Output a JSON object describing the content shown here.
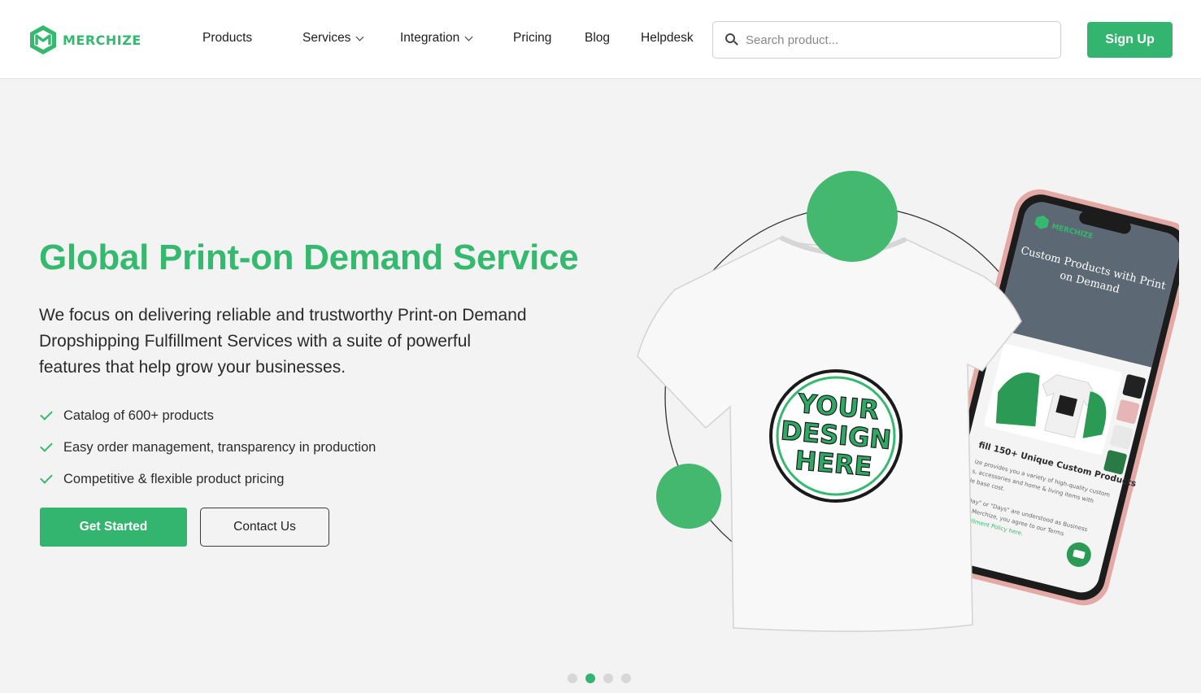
{
  "brand": {
    "name": "MERCHIZE",
    "accent_color": "#35b96f"
  },
  "nav": {
    "items": [
      {
        "label": "Products",
        "has_dropdown": false
      },
      {
        "label": "Services",
        "has_dropdown": true
      },
      {
        "label": "Integration",
        "has_dropdown": true
      },
      {
        "label": "Pricing",
        "has_dropdown": false
      },
      {
        "label": "Blog",
        "has_dropdown": false
      },
      {
        "label": "Helpdesk",
        "has_dropdown": false
      }
    ]
  },
  "search": {
    "placeholder": "Search product...",
    "value": ""
  },
  "signup": {
    "label": "Sign Up"
  },
  "hero": {
    "title": "Global Print-on Demand Service",
    "description": "We focus on delivering reliable and trustworthy Print-on Demand Dropshipping Fulfillment Services with a suite of powerful features that help grow your businesses.",
    "features": [
      "Catalog of 600+ products",
      "Easy order management, transparency in production",
      "Competitive & flexible product pricing"
    ],
    "primary_cta": "Get Started",
    "secondary_cta": "Contact Us"
  },
  "illustration": {
    "shirt_print": [
      "YOUR",
      "DESIGN",
      "HERE"
    ],
    "phone_logo": "MERCHIZE",
    "phone_banner": [
      "Custom Products with Print",
      "on Demand"
    ],
    "phone_heading": "fill 150+ Unique Custom Products",
    "phone_text": [
      "ize provides you a variety of high-quality custom",
      "s, accessories and home & living items with",
      "le base cost.",
      "\"Day\" or \"Days\" are understood as Business",
      "ng Merchize, you agree to our Terms",
      "Fulfillment Policy here."
    ]
  },
  "carousel": {
    "total": 4,
    "active_index": 1
  }
}
